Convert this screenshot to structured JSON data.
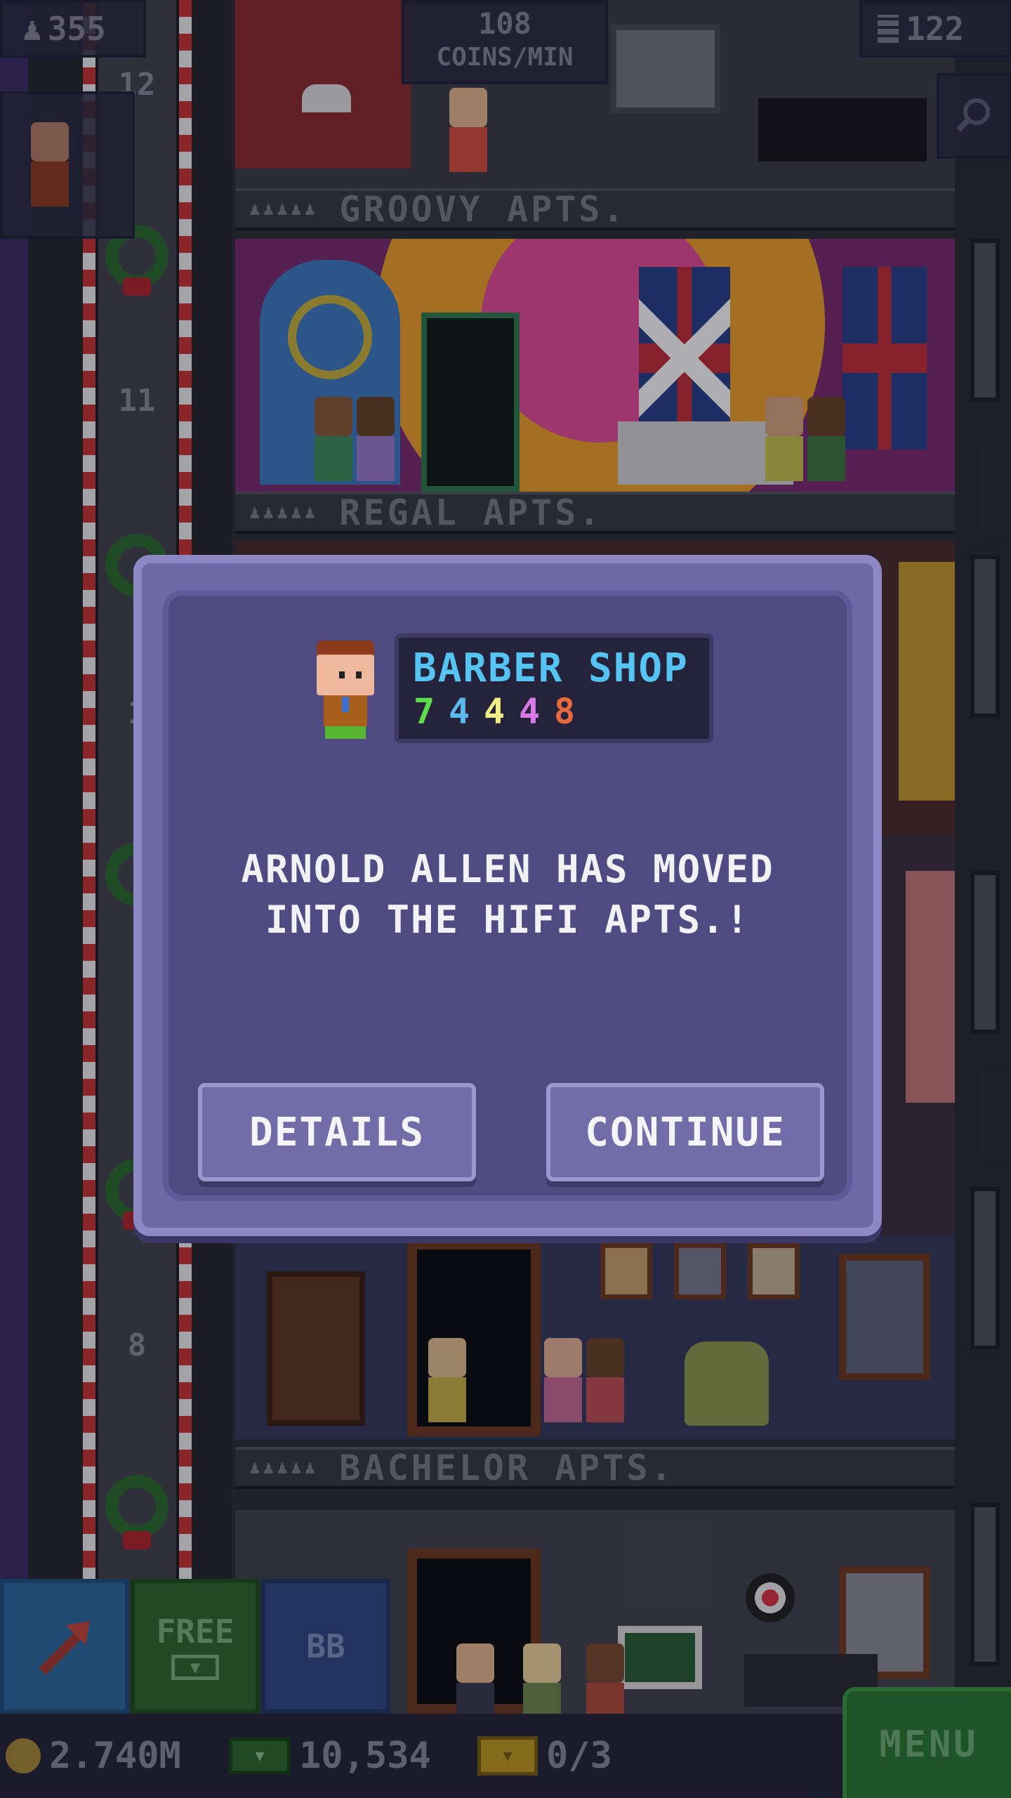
{
  "hud": {
    "population": "355",
    "coins_per_min_value": "108",
    "coins_per_min_unit": "COINS/MIN",
    "floor_count": "122",
    "population_icon": "person-icon",
    "floors_icon": "building-icon",
    "search_icon": "magnifier-icon"
  },
  "tower": {
    "floor_numbers": [
      "12",
      "11",
      "1",
      "8"
    ],
    "floor_labels": [
      {
        "people": "♟♟♟♟♟",
        "name": "GROOVY APTS."
      },
      {
        "people": "♟♟♟♟♟",
        "name": "REGAL APTS."
      },
      {
        "people": "♟♟♟♟♟",
        "name": "BACHELOR APTS."
      }
    ]
  },
  "dialog": {
    "business_name": "BARBER SHOP",
    "stock_levels": [
      {
        "value": "7",
        "color": "#5fdc4a"
      },
      {
        "value": "4",
        "color": "#5db8ee"
      },
      {
        "value": "4",
        "color": "#f2ee86"
      },
      {
        "value": "4",
        "color": "#d97ae6"
      },
      {
        "value": "8",
        "color": "#e76a3f"
      }
    ],
    "message_line1": "ARNOLD ALLEN HAS MOVED",
    "message_line2": "INTO THE HIFI APTS.!",
    "details_label": "DETAILS",
    "continue_label": "CONTINUE"
  },
  "toolbar": {
    "free_label": "FREE",
    "bb_label": "BB",
    "coins": "2.740M",
    "bux": "10,534",
    "vip": "0/3",
    "menu_label": "MENU",
    "raise_icon": "up-arrow-icon"
  },
  "colors": {
    "dialog_bg": "#4f4b82",
    "dialog_frame": "#6f68a6",
    "business_name": "#56c4f2",
    "menu_green": "#2a7a32"
  }
}
